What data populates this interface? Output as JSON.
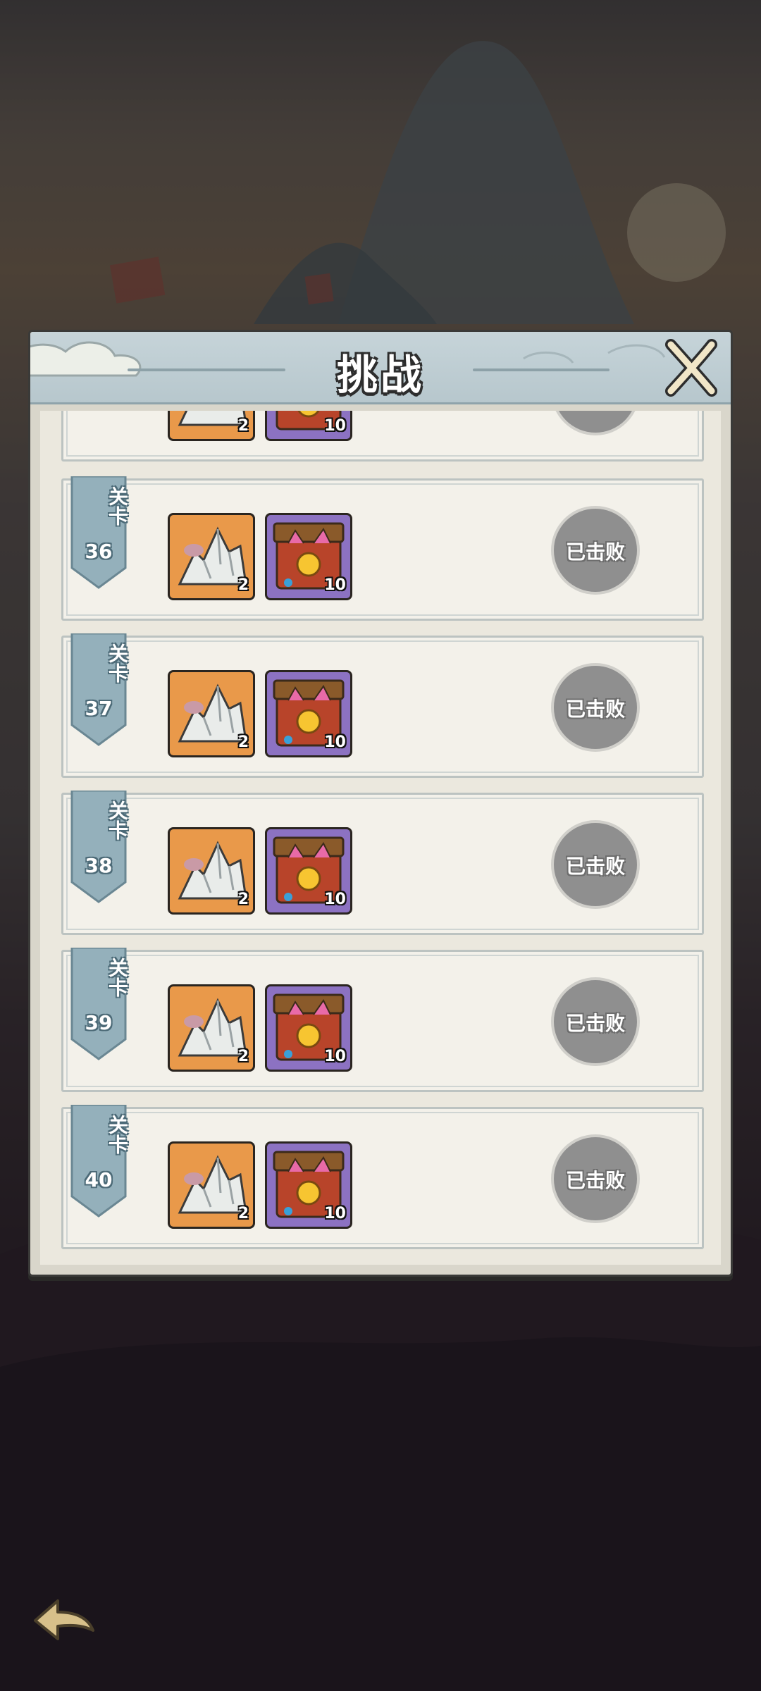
{
  "dialog": {
    "title": "挑战"
  },
  "partial_row": {
    "stone_count": "2",
    "chest_count": "10"
  },
  "stages": [
    {
      "label": "关卡",
      "number": "36",
      "stone_count": "2",
      "chest_count": "10",
      "status": "已击败"
    },
    {
      "label": "关卡",
      "number": "37",
      "stone_count": "2",
      "chest_count": "10",
      "status": "已击败"
    },
    {
      "label": "关卡",
      "number": "38",
      "stone_count": "2",
      "chest_count": "10",
      "status": "已击败"
    },
    {
      "label": "关卡",
      "number": "39",
      "stone_count": "2",
      "chest_count": "10",
      "status": "已击败"
    },
    {
      "label": "关卡",
      "number": "40",
      "stone_count": "2",
      "chest_count": "10",
      "status": "已击败"
    }
  ],
  "colors": {
    "header": "#b7c7cd",
    "panel": "#d9d6cb",
    "row": "#f3f1ea",
    "stone_bg": "#e9994a",
    "chest_bg": "#8c72c2",
    "defeated_badge": "#8f8f8f"
  },
  "icons": {
    "close": "close-icon",
    "back": "back-arrow-icon",
    "stone_reward": "mountain-stone-icon",
    "chest_reward": "treasure-chest-icon"
  }
}
